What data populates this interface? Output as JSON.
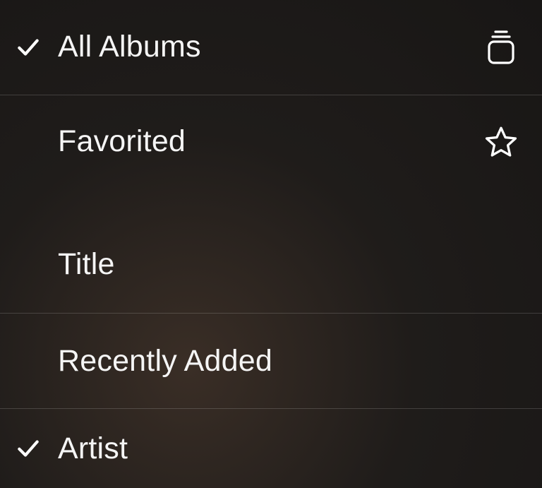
{
  "filterSection": {
    "items": [
      {
        "label": "All Albums",
        "checked": true,
        "icon": "stack"
      },
      {
        "label": "Favorited",
        "checked": false,
        "icon": "star"
      }
    ]
  },
  "sortSection": {
    "items": [
      {
        "label": "Title",
        "checked": false
      },
      {
        "label": "Recently Added",
        "checked": false
      },
      {
        "label": "Artist",
        "checked": true
      }
    ]
  }
}
